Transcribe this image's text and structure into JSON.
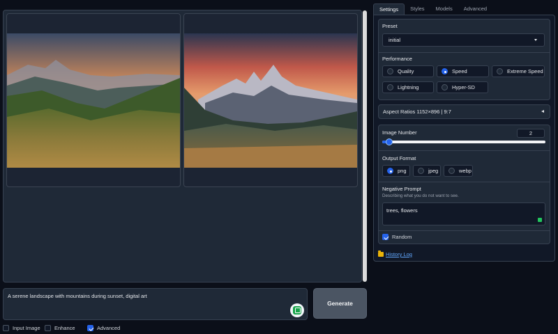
{
  "tabs": [
    "Settings",
    "Styles",
    "Models",
    "Advanced"
  ],
  "gallery": {
    "images": [
      {
        "icon": "landscape-sunset-hills-image"
      },
      {
        "icon": "landscape-mountain-peaks-image"
      }
    ]
  },
  "prompt": {
    "value": "A serene landscape with mountains during sunset, digital art",
    "icon": "prompt-assist-icon"
  },
  "generate_label": "Generate",
  "bottom_options": [
    {
      "label": "Input Image",
      "checked": false
    },
    {
      "label": "Enhance",
      "checked": false
    },
    {
      "label": "Advanced",
      "checked": true
    }
  ],
  "settings": {
    "preset_label": "Preset",
    "preset_value": "initial",
    "performance_label": "Performance",
    "performance_options": [
      {
        "label": "Quality",
        "selected": false
      },
      {
        "label": "Speed",
        "selected": true
      },
      {
        "label": "Extreme Speed",
        "selected": false
      },
      {
        "label": "Lightning",
        "selected": false
      },
      {
        "label": "Hyper-SD",
        "selected": false
      }
    ],
    "aspect_label": "Aspect Ratios 1152×896 | 9:7",
    "image_number_label": "Image Number",
    "image_number_value": "2",
    "output_format_label": "Output Format",
    "output_formats": [
      {
        "label": "png",
        "selected": true
      },
      {
        "label": "jpeg",
        "selected": false
      },
      {
        "label": "webp",
        "selected": false
      }
    ],
    "negative_prompt_label": "Negative Prompt",
    "negative_prompt_hint": "Describing what you do not want to see.",
    "negative_prompt_value": "trees, flowers",
    "random_label": "Random",
    "random_checked": true,
    "history_label": "History Log"
  },
  "colors": {
    "background": "#0b0f19",
    "panel": "#1f2937",
    "accent": "#2563eb",
    "link": "#60a5fa"
  }
}
